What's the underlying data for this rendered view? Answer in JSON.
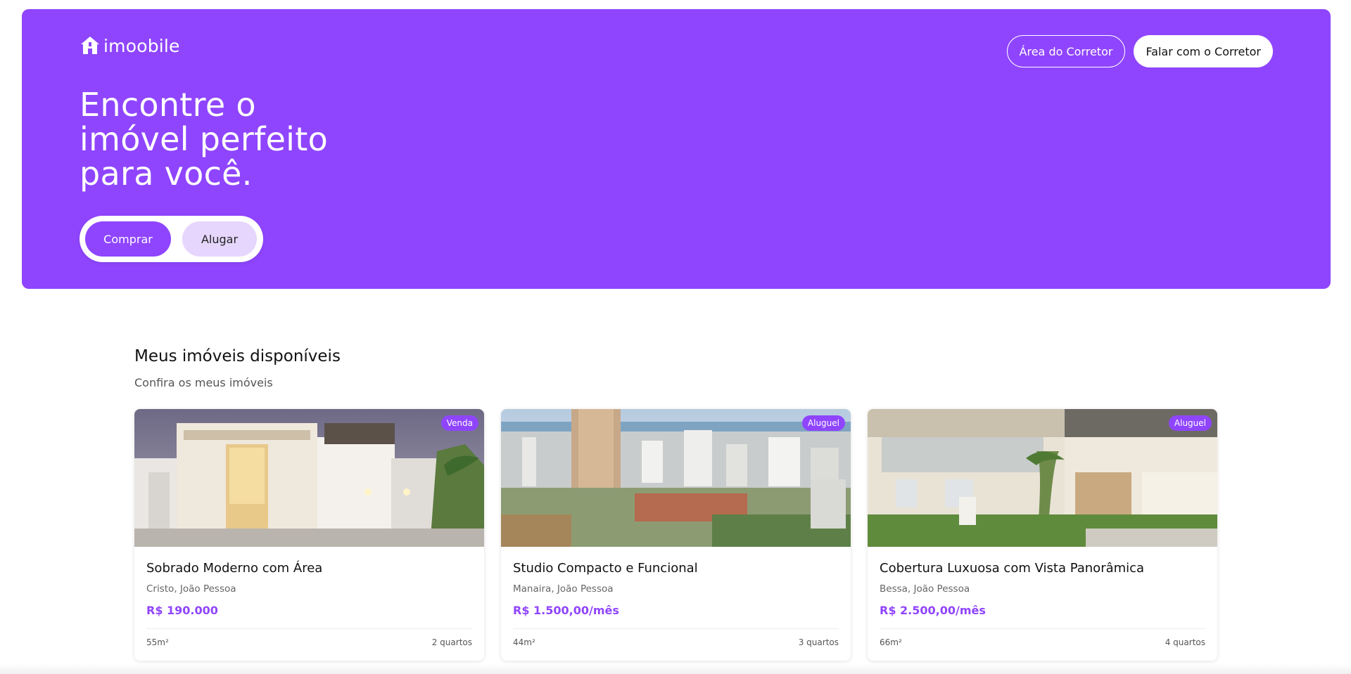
{
  "brand": {
    "name": "imoobile",
    "accent": "#8f45fd"
  },
  "header": {
    "broker_area_label": "Área do Corretor",
    "contact_broker_label": "Falar com o Corretor"
  },
  "hero": {
    "title": "Encontre o imóvel perfeito para você.",
    "toggle": {
      "buy_label": "Comprar",
      "rent_label": "Alugar",
      "selected": "Comprar"
    }
  },
  "listings": {
    "title": "Meus imóveis disponíveis",
    "subtitle": "Confira os meus imóveis",
    "items": [
      {
        "badge": "Venda",
        "title": "Sobrado Moderno com Área",
        "location": "Cristo, João Pessoa",
        "price": "R$ 190.000",
        "area": "55m²",
        "rooms": "2 quartos"
      },
      {
        "badge": "Aluguel",
        "title": "Studio Compacto e Funcional",
        "location": "Manaira, João Pessoa",
        "price": "R$ 1.500,00/mês",
        "area": "44m²",
        "rooms": "3 quartos"
      },
      {
        "badge": "Aluguel",
        "title": "Cobertura Luxuosa com Vista Panorâmica",
        "location": "Bessa, João Pessoa",
        "price": "R$ 2.500,00/mês",
        "area": "66m²",
        "rooms": "4 quartos"
      }
    ]
  }
}
